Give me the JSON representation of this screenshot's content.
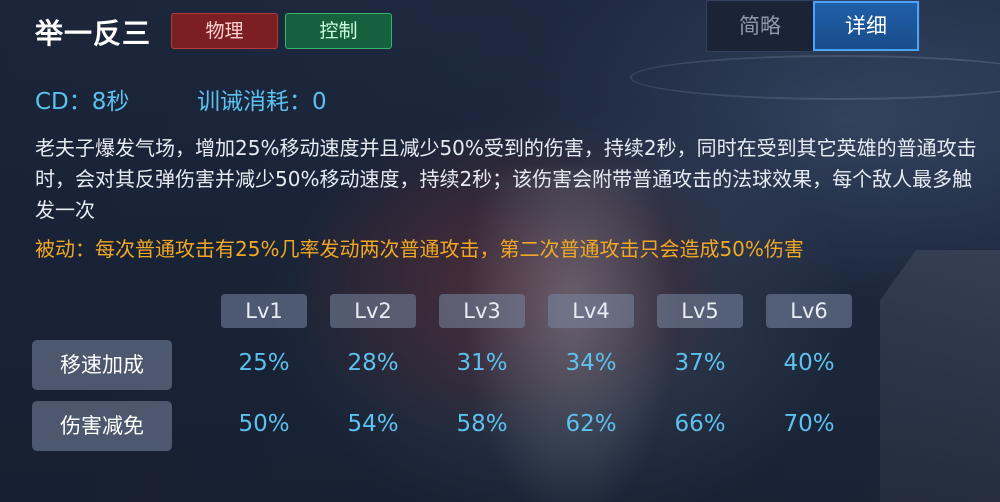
{
  "skill": {
    "name": "举一反三",
    "tags": [
      "物理",
      "控制"
    ]
  },
  "view_toggle": {
    "options": [
      "简略",
      "详细"
    ],
    "selected": "详细"
  },
  "stats": {
    "cd": "CD：8秒",
    "cost": "训诫消耗：0"
  },
  "description": "老夫子爆发气场，增加25%移动速度并且减少50%受到的伤害，持续2秒，同时在受到其它英雄的普通攻击时，会对其反弹伤害并减少50%移动速度，持续2秒；该伤害会附带普通攻击的法球效果，每个敌人最多触发一次",
  "passive": "被动：每次普通攻击有25%几率发动两次普通攻击，第二次普通攻击只会造成50%伤害",
  "level_table": {
    "levels": [
      "Lv1",
      "Lv2",
      "Lv3",
      "Lv4",
      "Lv5",
      "Lv6"
    ],
    "rows": [
      {
        "label": "移速加成",
        "values": [
          "25%",
          "28%",
          "31%",
          "34%",
          "37%",
          "40%"
        ]
      },
      {
        "label": "伤害减免",
        "values": [
          "50%",
          "54%",
          "58%",
          "62%",
          "66%",
          "70%"
        ]
      }
    ]
  },
  "colors": {
    "physics_tag": "#7c1f23",
    "control_tag": "#16603e",
    "stat_text": "#5cc1ee",
    "passive_text": "#f2a823",
    "toggle_active": "#1f5fa8"
  }
}
